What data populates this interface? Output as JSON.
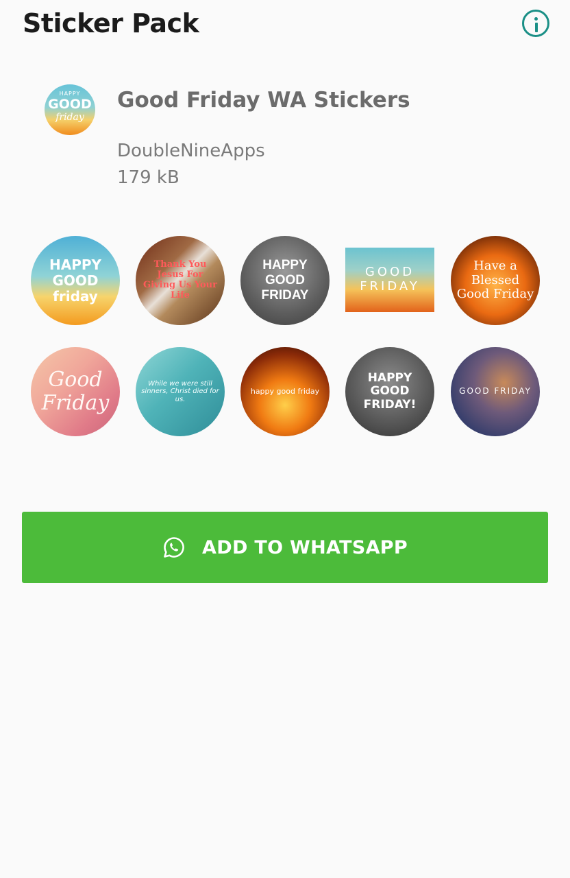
{
  "app_bar": {
    "title": "Sticker Pack",
    "info_icon": "info-icon"
  },
  "pack": {
    "icon": "pack-tray-icon",
    "icon_text": [
      "HAPPY",
      "GOOD",
      "friday"
    ],
    "name": "Good Friday WA Stickers",
    "publisher": "DoubleNineApps",
    "size": "179 kB"
  },
  "stickers": [
    {
      "text": "HAPPY GOOD friday"
    },
    {
      "text": "Thank You Jesus For Giving Us Your Life"
    },
    {
      "text": "HAPPY GOOD FRIDAY"
    },
    {
      "text": "GOOD FRIDAY"
    },
    {
      "text": "Have a Blessed Good Friday"
    },
    {
      "text": "Good Friday"
    },
    {
      "text": "While we were still sinners, Christ died for us."
    },
    {
      "text": "happy good friday"
    },
    {
      "text": "HAPPY GOOD FRIDAY!"
    },
    {
      "text": "GOOD FRIDAY"
    }
  ],
  "add_button": {
    "label": "ADD TO WHATSAPP",
    "icon": "whatsapp-icon"
  },
  "colors": {
    "accent": "#1a8f86",
    "button": "#4cbb3a",
    "background": "#fafafa"
  }
}
